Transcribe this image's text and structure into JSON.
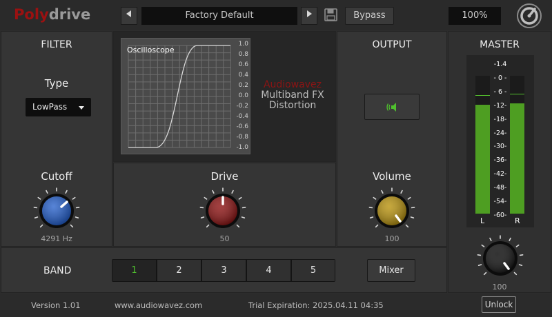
{
  "header": {
    "logo_part1": "Poly",
    "logo_part2": "drive",
    "prev_icon": "triangle-left-icon",
    "next_icon": "triangle-right-icon",
    "preset_name": "Factory Default",
    "save_icon": "floppy-disk-icon",
    "bypass_label": "Bypass",
    "zoom_value": "100%",
    "brand_icon": "gauge-logo-icon"
  },
  "filter": {
    "title": "FILTER",
    "type_label": "Type",
    "type_value": "LowPass",
    "cutoff_label": "Cutoff",
    "cutoff_value": "4291 Hz",
    "knob_color": "#1f5bc9"
  },
  "scope": {
    "label": "Oscilloscope",
    "ticks": [
      "1.0",
      "0.8",
      "0.6",
      "0.4",
      "0.2",
      "0.0",
      "-0.2",
      "-0.4",
      "-0.6",
      "-0.8",
      "-1.0"
    ],
    "brand_line1": "Audiowavez",
    "brand_line2": "Multiband FX",
    "brand_line3": "Distortion"
  },
  "drive": {
    "label": "Drive",
    "value": "50",
    "knob_color": "#8c1010"
  },
  "output": {
    "title": "OUTPUT",
    "button_icon": "speaker-icon",
    "volume_label": "Volume",
    "volume_value": "100",
    "knob_color": "#b8920c"
  },
  "master": {
    "title": "MASTER",
    "scale": [
      "-1.4",
      "- 0 -",
      "- 6 -",
      "-12-",
      "-18-",
      "-24-",
      "-30-",
      "-36-",
      "-42-",
      "-48-",
      "-54-",
      "-60-"
    ],
    "left_label": "L",
    "right_label": "R",
    "level_left": 0.79,
    "level_right": 0.8,
    "knob_value": "100"
  },
  "band": {
    "title": "BAND",
    "buttons": [
      "1",
      "2",
      "3",
      "4",
      "5"
    ],
    "active_index": 0,
    "mixer_label": "Mixer"
  },
  "footer": {
    "version": "Version 1.01",
    "website": "www.audiowavez.com",
    "trial": "Trial Expiration: 2025.04.11 04:35",
    "unlock_label": "Unlock"
  }
}
